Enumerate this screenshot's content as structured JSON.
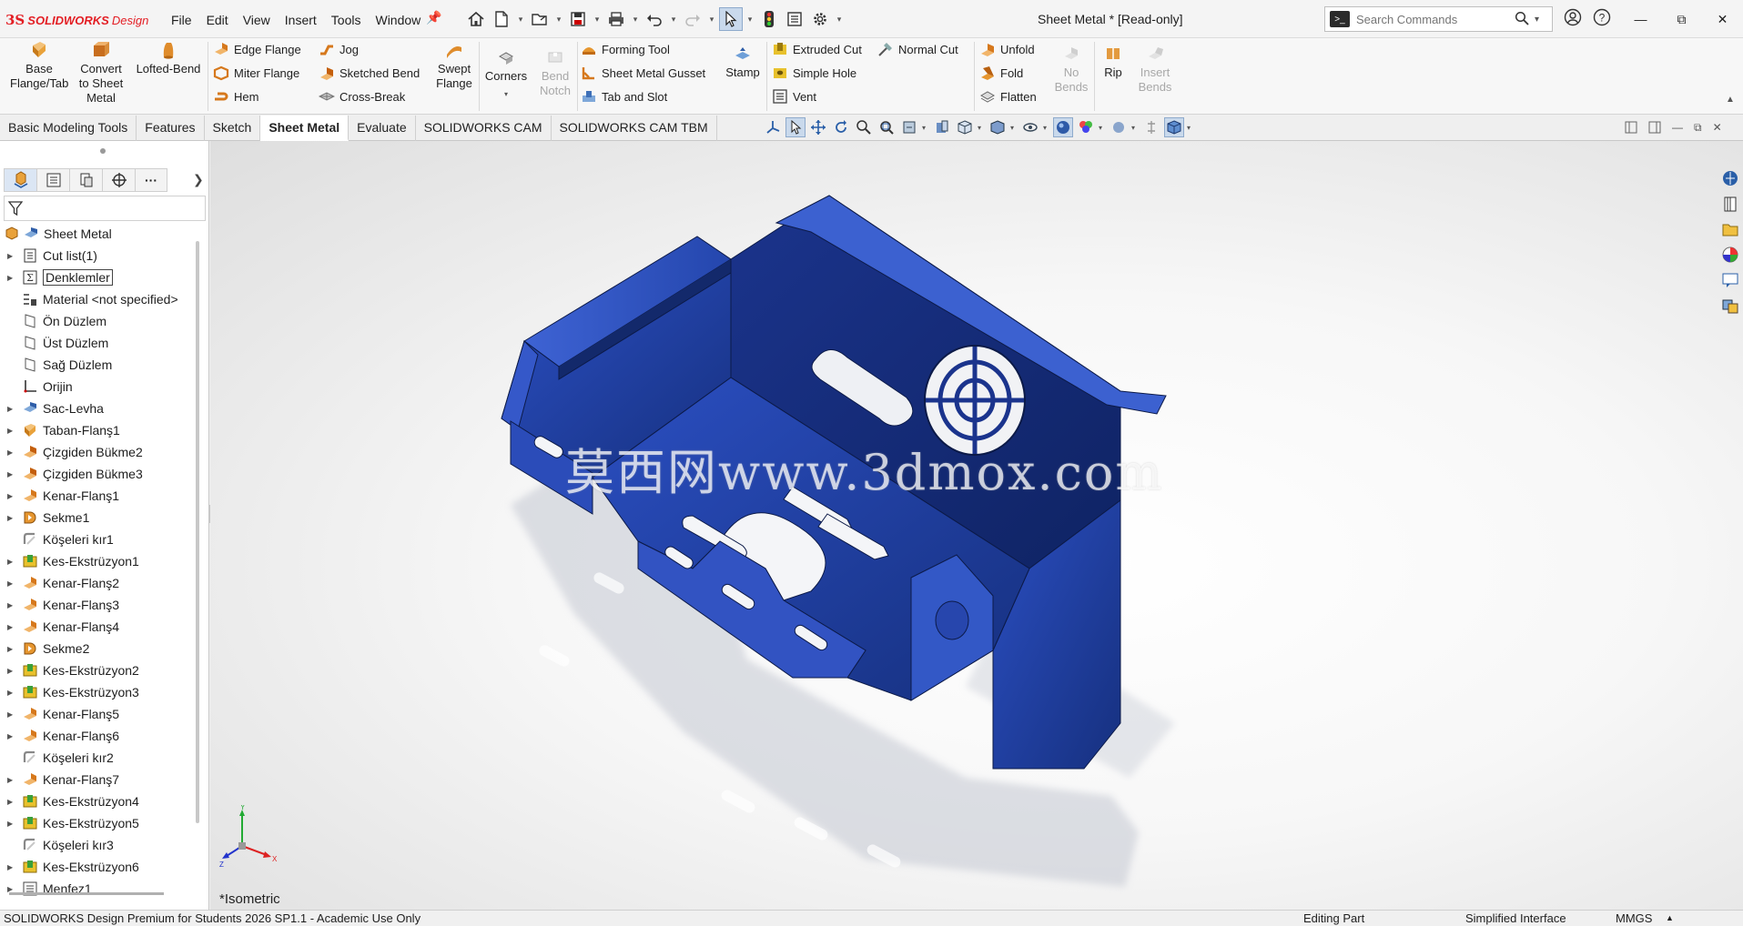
{
  "app": {
    "logo_ds": "3S",
    "logo_brand": "SOLIDWORKS",
    "logo_edition": "Design",
    "document_title": "Sheet Metal * [Read-only]"
  },
  "menu": [
    "File",
    "Edit",
    "View",
    "Insert",
    "Tools",
    "Window"
  ],
  "search": {
    "placeholder": "Search Commands"
  },
  "ribbon": {
    "base_flange": "Base Flange/Tab",
    "convert": "Convert to Sheet Metal",
    "lofted_bend": "Lofted-Bend",
    "edge_flange": "Edge Flange",
    "miter_flange": "Miter Flange",
    "hem": "Hem",
    "jog": "Jog",
    "sketched_bend": "Sketched Bend",
    "cross_break": "Cross-Break",
    "swept_flange": "Swept Flange",
    "corners": "Corners",
    "bend_notch": "Bend Notch",
    "forming_tool": "Forming Tool",
    "sheet_metal_gusset": "Sheet Metal Gusset",
    "tab_and_slot": "Tab and Slot",
    "stamp": "Stamp",
    "extruded_cut": "Extruded Cut",
    "simple_hole": "Simple Hole",
    "vent": "Vent",
    "normal_cut": "Normal Cut",
    "unfold": "Unfold",
    "fold": "Fold",
    "flatten": "Flatten",
    "no_bends": "No Bends",
    "rip": "Rip",
    "insert_bends": "Insert Bends"
  },
  "tabs": [
    {
      "label": "Basic Modeling Tools",
      "active": false
    },
    {
      "label": "Features",
      "active": false
    },
    {
      "label": "Sketch",
      "active": false
    },
    {
      "label": "Sheet Metal",
      "active": true
    },
    {
      "label": "Evaluate",
      "active": false
    },
    {
      "label": "SOLIDWORKS CAM",
      "active": false
    },
    {
      "label": "SOLIDWORKS CAM TBM",
      "active": false
    }
  ],
  "tree": {
    "root": "Sheet Metal",
    "items": [
      {
        "label": "Cut list(1)",
        "icon": "cutlist-icon",
        "expandable": true
      },
      {
        "label": "Denklemler",
        "icon": "equations-icon",
        "expandable": true,
        "boxed": true
      },
      {
        "label": "Material <not specified>",
        "icon": "material-icon",
        "expandable": false
      },
      {
        "label": "Ön Düzlem",
        "icon": "plane-icon",
        "expandable": false
      },
      {
        "label": "Üst Düzlem",
        "icon": "plane-icon",
        "expandable": false
      },
      {
        "label": "Sağ Düzlem",
        "icon": "plane-icon",
        "expandable": false
      },
      {
        "label": "Orijin",
        "icon": "origin-icon",
        "expandable": false
      },
      {
        "label": "Sac-Levha",
        "icon": "sheetmetal-icon",
        "expandable": true
      },
      {
        "label": "Taban-Flanş1",
        "icon": "base-flange-icon",
        "expandable": true
      },
      {
        "label": "Çizgiden Bükme2",
        "icon": "sketched-bend-icon",
        "expandable": true
      },
      {
        "label": "Çizgiden Bükme3",
        "icon": "sketched-bend-icon",
        "expandable": true
      },
      {
        "label": "Kenar-Flanş1",
        "icon": "edge-flange-icon",
        "expandable": true
      },
      {
        "label": "Sekme1",
        "icon": "tab-icon",
        "expandable": true
      },
      {
        "label": "Köşeleri kır1",
        "icon": "corner-icon",
        "expandable": false
      },
      {
        "label": "Kes-Ekstrüzyon1",
        "icon": "cut-extrude-icon",
        "expandable": true
      },
      {
        "label": "Kenar-Flanş2",
        "icon": "edge-flange-icon",
        "expandable": true
      },
      {
        "label": "Kenar-Flanş3",
        "icon": "edge-flange-icon",
        "expandable": true
      },
      {
        "label": "Kenar-Flanş4",
        "icon": "edge-flange-icon",
        "expandable": true
      },
      {
        "label": "Sekme2",
        "icon": "tab-icon",
        "expandable": true
      },
      {
        "label": "Kes-Ekstrüzyon2",
        "icon": "cut-extrude-icon",
        "expandable": true
      },
      {
        "label": "Kes-Ekstrüzyon3",
        "icon": "cut-extrude-icon",
        "expandable": true
      },
      {
        "label": "Kenar-Flanş5",
        "icon": "edge-flange-icon",
        "expandable": true
      },
      {
        "label": "Kenar-Flanş6",
        "icon": "edge-flange-icon",
        "expandable": true
      },
      {
        "label": "Köşeleri kır2",
        "icon": "corner-icon",
        "expandable": false
      },
      {
        "label": "Kenar-Flanş7",
        "icon": "edge-flange-icon",
        "expandable": true
      },
      {
        "label": "Kes-Ekstrüzyon4",
        "icon": "cut-extrude-icon",
        "expandable": true
      },
      {
        "label": "Kes-Ekstrüzyon5",
        "icon": "cut-extrude-icon",
        "expandable": true
      },
      {
        "label": "Köşeleri kır3",
        "icon": "corner-icon",
        "expandable": false
      },
      {
        "label": "Kes-Ekstrüzyon6",
        "icon": "cut-extrude-icon",
        "expandable": true
      },
      {
        "label": "Menfez1",
        "icon": "vent-icon",
        "expandable": true
      }
    ]
  },
  "viewport": {
    "view_name": "*Isometric",
    "watermark": "莫西网www.3dmox.com",
    "triad": {
      "x": "X",
      "y": "Y",
      "z": "Z"
    }
  },
  "status": {
    "product": "SOLIDWORKS Design Premium for Students 2026 SP1.1 - Academic Use Only",
    "mode": "Editing Part",
    "interface": "Simplified Interface",
    "units": "MMGS"
  },
  "colors": {
    "part_blue": "#1f3a9c",
    "brand_red": "#e31e24",
    "selection": "#c9d9ec"
  }
}
